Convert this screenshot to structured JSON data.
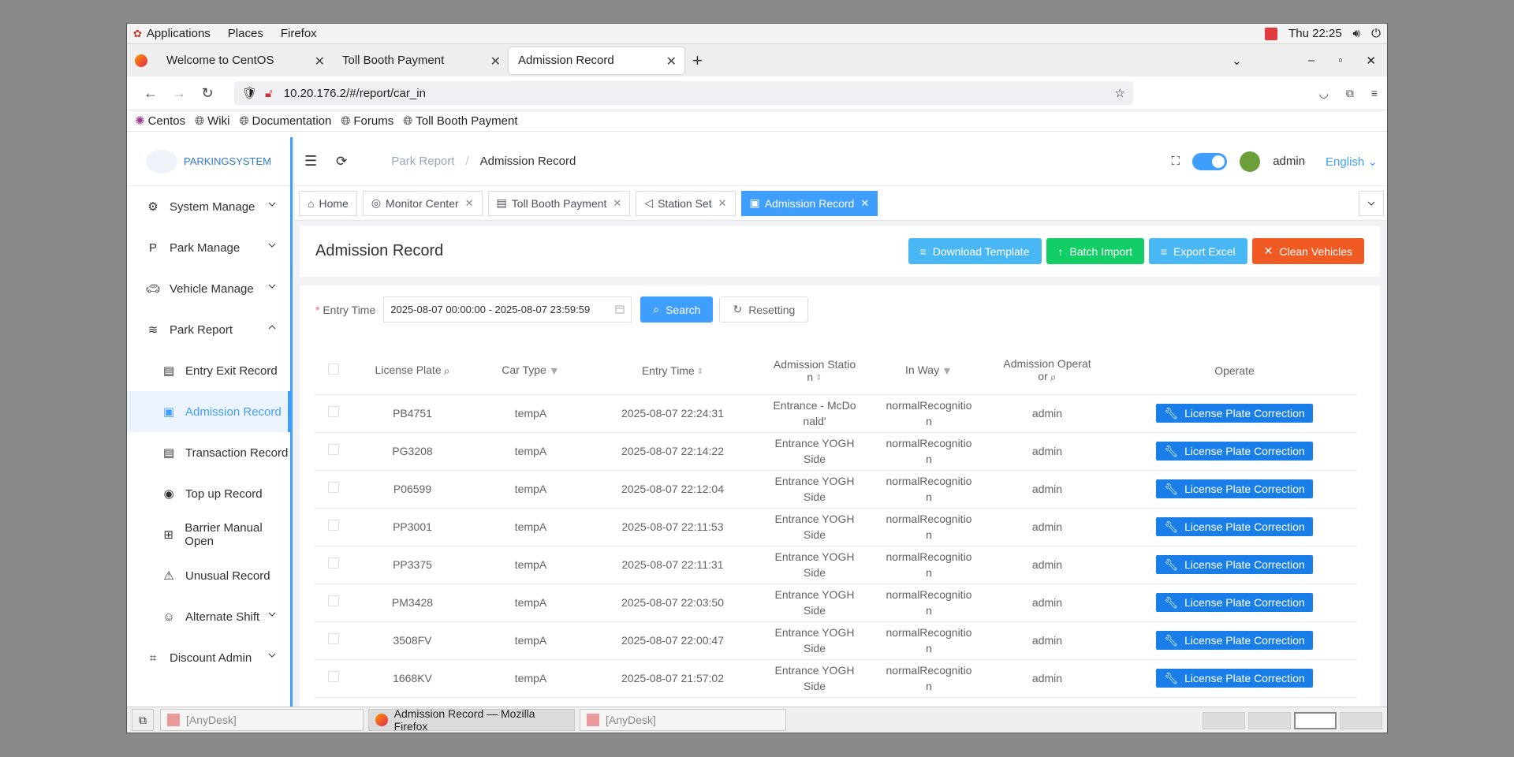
{
  "gnome": {
    "applications": "Applications",
    "places": "Places",
    "firefox": "Firefox",
    "clock": "Thu 22:25"
  },
  "browser": {
    "tabs": [
      {
        "label": "Welcome to CentOS"
      },
      {
        "label": "Toll Booth Payment"
      },
      {
        "label": "Admission Record"
      }
    ],
    "url": "10.20.176.2/#/report/car_in",
    "bookmarks": [
      "Centos",
      "Wiki",
      "Documentation",
      "Forums",
      "Toll Booth Payment"
    ]
  },
  "app": {
    "logo_text": "PARKINGSYSTEM",
    "menu": {
      "system_manage": "System Manage",
      "park_manage": "Park Manage",
      "vehicle_manage": "Vehicle Manage",
      "park_report": "Park Report",
      "entry_exit_record": "Entry Exit Record",
      "admission_record": "Admission Record",
      "transaction_record": "Transaction Record",
      "top_up_record": "Top up Record",
      "barrier_manual_open": "Barrier Manual Open",
      "unusual_record": "Unusual Record",
      "alternate_shift": "Alternate Shift",
      "discount_admin": "Discount Admin"
    },
    "breadcrumb": {
      "parent": "Park Report",
      "current": "Admission Record"
    },
    "user": "admin",
    "language": "English",
    "tags": {
      "home": "Home",
      "monitor": "Monitor Center",
      "toll": "Toll Booth Payment",
      "station": "Station Set",
      "admission": "Admission Record"
    },
    "page_title": "Admission Record",
    "buttons": {
      "download": "Download Template",
      "batch": "Batch Import",
      "export": "Export Excel",
      "clean": "Clean Vehicles"
    },
    "filter": {
      "label": "Entry Time",
      "range": "2025-08-07 00:00:00 - 2025-08-07 23:59:59",
      "search": "Search",
      "reset": "Resetting"
    },
    "table": {
      "headers": {
        "plate": "License Plate",
        "car_type": "Car Type",
        "entry_time": "Entry Time",
        "station_a": "Admission Statio",
        "station_b": "n",
        "in_way": "In Way",
        "operator_a": "Admission Operat",
        "operator_b": "or",
        "operate": "Operate"
      },
      "action": "License Plate Correction",
      "rows": [
        {
          "plate": "PB4751",
          "type": "tempA",
          "time": "2025-08-07 22:24:31",
          "station_a": "Entrance - McDo",
          "station_b": "nald'",
          "way_a": "normalRecognitio",
          "way_b": "n",
          "op": "admin"
        },
        {
          "plate": "PG3208",
          "type": "tempA",
          "time": "2025-08-07 22:14:22",
          "station_a": "Entrance YOGH",
          "station_b": "Side",
          "way_a": "normalRecognitio",
          "way_b": "n",
          "op": "admin"
        },
        {
          "plate": "P06599",
          "type": "tempA",
          "time": "2025-08-07 22:12:04",
          "station_a": "Entrance YOGH",
          "station_b": "Side",
          "way_a": "normalRecognitio",
          "way_b": "n",
          "op": "admin"
        },
        {
          "plate": "PP3001",
          "type": "tempA",
          "time": "2025-08-07 22:11:53",
          "station_a": "Entrance YOGH",
          "station_b": "Side",
          "way_a": "normalRecognitio",
          "way_b": "n",
          "op": "admin"
        },
        {
          "plate": "PP3375",
          "type": "tempA",
          "time": "2025-08-07 22:11:31",
          "station_a": "Entrance YOGH",
          "station_b": "Side",
          "way_a": "normalRecognitio",
          "way_b": "n",
          "op": "admin"
        },
        {
          "plate": "PM3428",
          "type": "tempA",
          "time": "2025-08-07 22:03:50",
          "station_a": "Entrance YOGH",
          "station_b": "Side",
          "way_a": "normalRecognitio",
          "way_b": "n",
          "op": "admin"
        },
        {
          "plate": "3508FV",
          "type": "tempA",
          "time": "2025-08-07 22:00:47",
          "station_a": "Entrance YOGH",
          "station_b": "Side",
          "way_a": "normalRecognitio",
          "way_b": "n",
          "op": "admin"
        },
        {
          "plate": "1668KV",
          "type": "tempA",
          "time": "2025-08-07 21:57:02",
          "station_a": "Entrance YOGH",
          "station_b": "Side",
          "way_a": "normalRecognitio",
          "way_b": "n",
          "op": "admin"
        }
      ]
    },
    "colors": {
      "primary": "#409eff",
      "success": "#13ce66",
      "info": "#4ab7f5",
      "danger": "#f05a23",
      "action": "#1a7ee8"
    }
  },
  "taskbar": {
    "items": [
      "[AnyDesk]",
      "Admission Record — Mozilla Firefox",
      "[AnyDesk]"
    ]
  }
}
